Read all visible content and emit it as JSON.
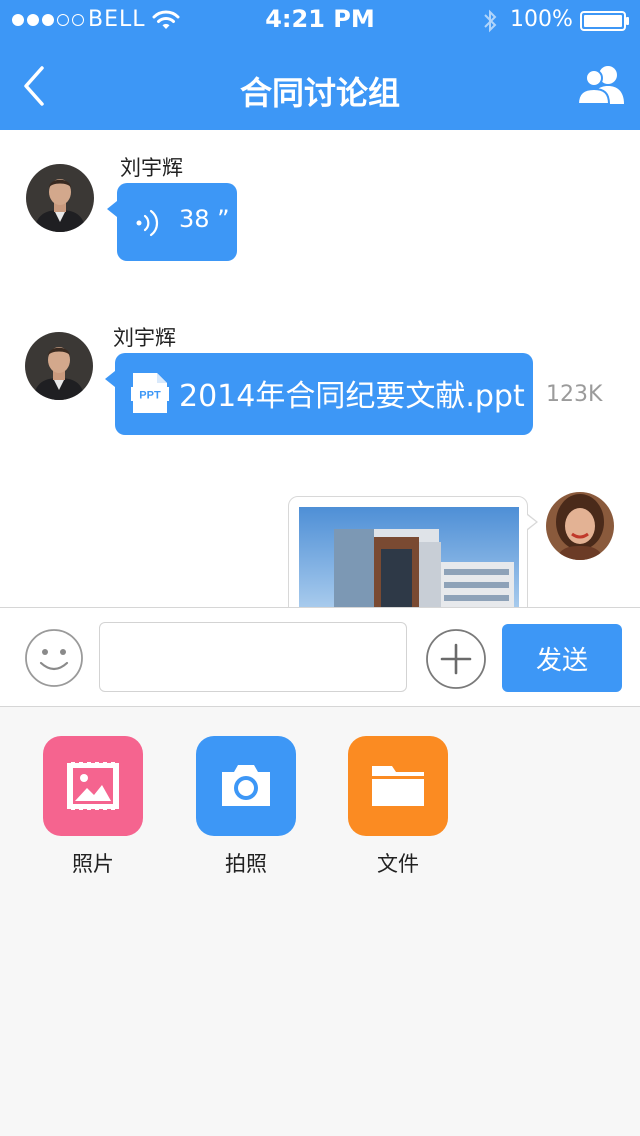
{
  "status_bar": {
    "carrier": "BELL",
    "time": "4:21 PM",
    "battery": "100%",
    "icons": [
      "signal-dots",
      "wifi-icon",
      "bluetooth-icon",
      "battery-icon"
    ]
  },
  "nav": {
    "title": "合同讨论组",
    "back_icon": "chevron-left-icon",
    "members_icon": "group-icon"
  },
  "messages": [
    {
      "sender": "刘宇辉",
      "type": "voice",
      "duration": "38 ”",
      "icon": "voice-wave-icon"
    },
    {
      "sender": "刘宇辉",
      "type": "file",
      "file_badge": "PPT",
      "file_name": "2014年合同纪要文献.ppt",
      "file_size": "123K"
    },
    {
      "type": "image",
      "outgoing": true
    }
  ],
  "input_bar": {
    "emoji_icon": "smiley-icon",
    "input_value": "",
    "input_placeholder": "",
    "plus_icon": "plus-icon",
    "send_label": "发送"
  },
  "attachments": [
    {
      "label": "照片",
      "icon": "photo-icon",
      "color": "#f5648f"
    },
    {
      "label": "拍照",
      "icon": "camera-icon",
      "color": "#3d97f6"
    },
    {
      "label": "文件",
      "icon": "folder-icon",
      "color": "#fb8b22"
    }
  ],
  "colors": {
    "accent": "#3d97f6",
    "panel_bg": "#f7f7f7",
    "muted_text": "#9b9b9b"
  }
}
